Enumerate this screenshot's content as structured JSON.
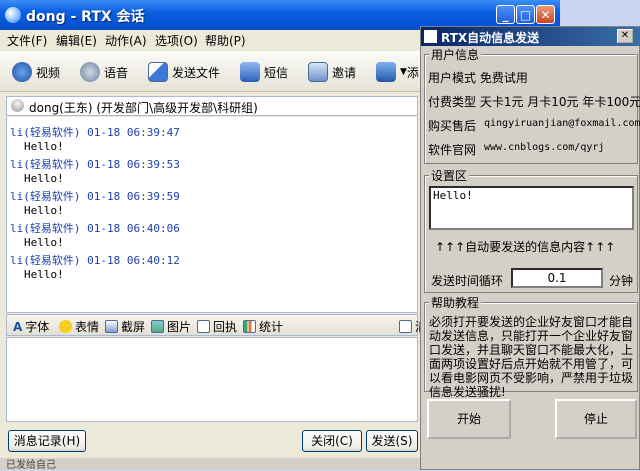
{
  "main_window": {
    "title": "dong - RTX 会话",
    "menu": [
      "文件(F)",
      "编辑(E)",
      "动作(A)",
      "选项(O)",
      "帮助(P)"
    ],
    "toolbar": {
      "video": "视频",
      "voice": "语音",
      "send_file": "发送文件",
      "sms": "短信",
      "invite": "邀请",
      "more": "添"
    },
    "conversation_with": "dong(王东) (开发部门\\高级开发部\\科研组)",
    "messages": [
      {
        "sender": "li(轻易软件)",
        "time": "01-18 06:39:47",
        "text": "Hello!"
      },
      {
        "sender": "li(轻易软件)",
        "time": "01-18 06:39:53",
        "text": "Hello!"
      },
      {
        "sender": "li(轻易软件)",
        "time": "01-18 06:39:59",
        "text": "Hello!"
      },
      {
        "sender": "li(轻易软件)",
        "time": "01-18 06:40:06",
        "text": "Hello!"
      },
      {
        "sender": "li(轻易软件)",
        "time": "01-18 06:40:12",
        "text": "Hello!"
      }
    ],
    "format_bar": {
      "font": "字体",
      "emoticon": "表情",
      "screenshot": "截屏",
      "image": "图片",
      "receipt": "回执",
      "stats": "统计",
      "clear": "清"
    },
    "buttons": {
      "history": "消息记录(H)",
      "close": "关闭(C)",
      "send": "发送(S)"
    }
  },
  "rtx_window": {
    "title": "RTX自动信息发送",
    "user_info": {
      "section": "用户信息",
      "mode": "用户模式  免费试用",
      "payment": "付费类型  天卡1元  月卡10元  年卡100元",
      "seller_label": "购买售后",
      "seller_email": "qingyiruanjian@foxmail.com",
      "site_label": "软件官网",
      "site_url": "www.cnblogs.com/qyrj"
    },
    "settings": {
      "section": "设置区",
      "message": "Hello!",
      "hint": "↑↑↑自动要发送的信息内容↑↑↑",
      "interval_label": "发送时间循环",
      "interval_value": "0.1",
      "interval_unit": "分钟"
    },
    "help": {
      "section": "帮助教程",
      "text": "必须打开要发送的企业好友窗口才能自动发送信息，只能打开一个企业好友窗口发送，并且聊天窗口不能最大化，上面两项设置好后点开始就不用管了，可以看电影网页不受影响，严禁用于垃圾信息发送骚扰!"
    },
    "buttons": {
      "start": "开始",
      "stop": "停止"
    }
  },
  "status_text": "已发给自己"
}
